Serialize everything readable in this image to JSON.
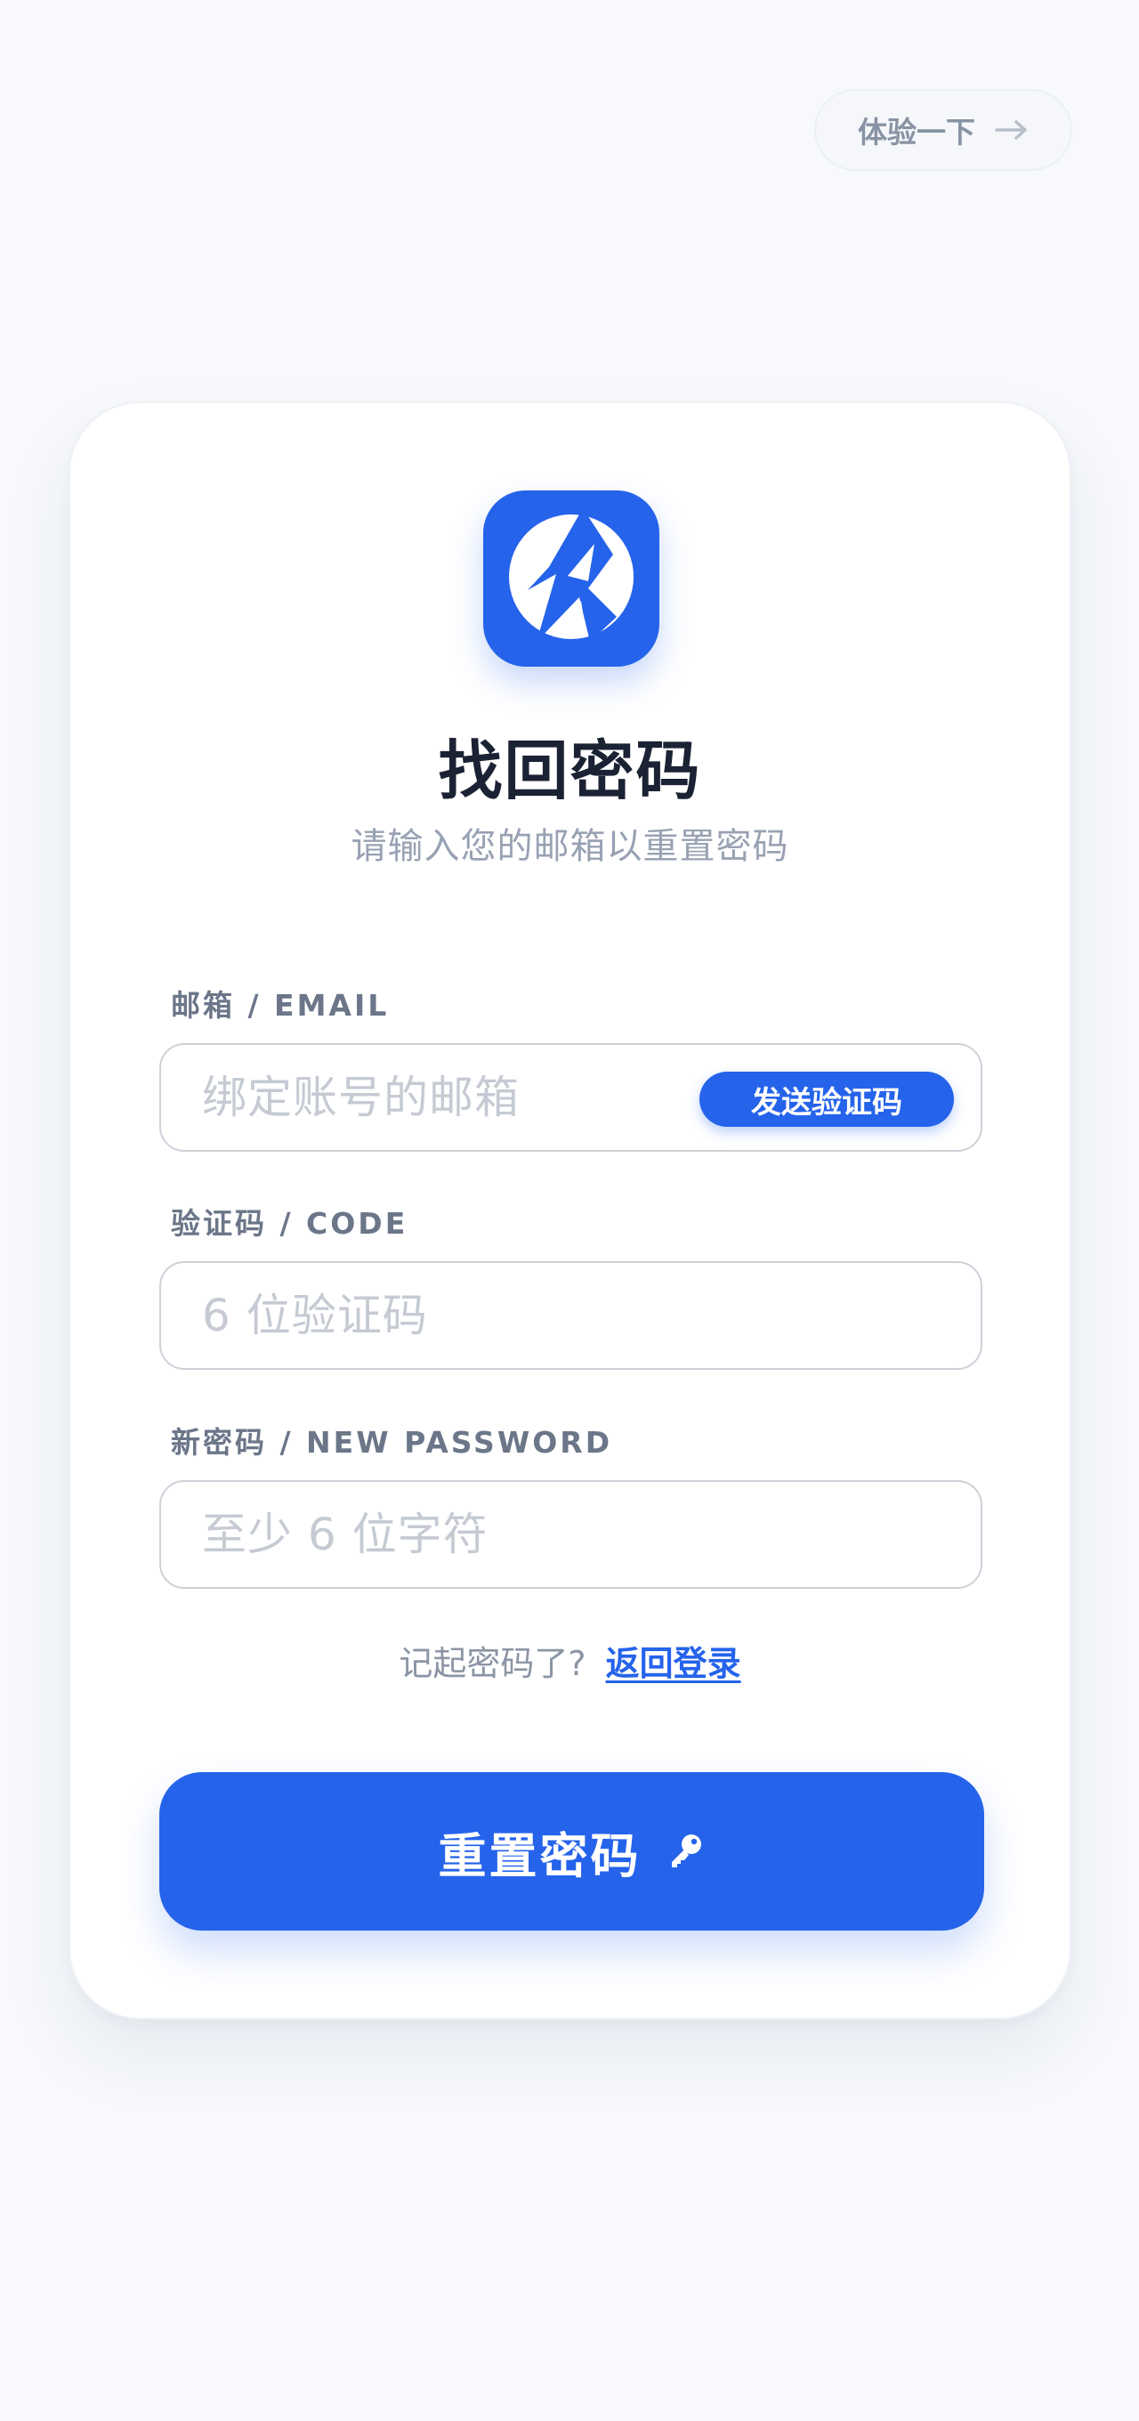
{
  "header": {
    "try_button_label": "体验一下"
  },
  "card": {
    "title": "找回密码",
    "subtitle": "请输入您的邮箱以重置密码",
    "email": {
      "label": "邮箱 / EMAIL",
      "placeholder": "绑定账号的邮箱",
      "value": "",
      "send_code_label": "发送验证码"
    },
    "code": {
      "label": "验证码 / CODE",
      "placeholder": "6 位验证码",
      "value": ""
    },
    "new_password": {
      "label": "新密码 / NEW PASSWORD",
      "placeholder": "至少 6 位字符",
      "value": ""
    },
    "back_prompt": "记起密码了?",
    "back_link": "返回登录",
    "submit_label": "重置密码"
  },
  "icons": {
    "logo": "k-logo-icon",
    "try_arrow": "arrow-right-icon",
    "submit": "key-icon"
  },
  "colors": {
    "accent": "#2563eb",
    "background": "#f7f9fc",
    "title": "#1b2233",
    "muted": "#98a2b3"
  }
}
